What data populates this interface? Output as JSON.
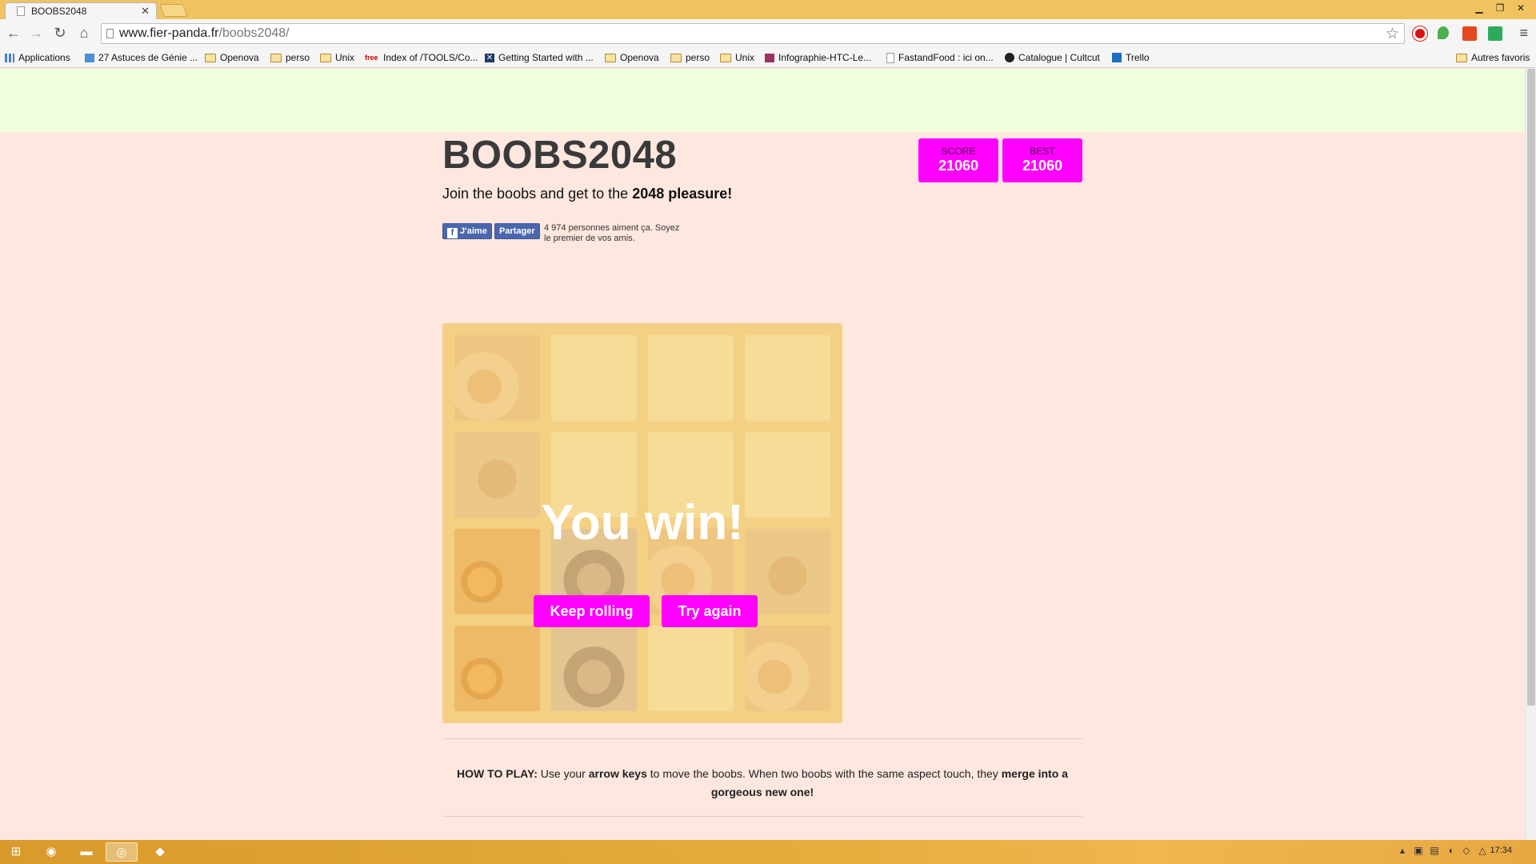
{
  "browser": {
    "tab_title": "BOOBS2048",
    "url_host": "www.fier-panda.fr",
    "url_path": "/boobs2048/",
    "bookmarks": [
      {
        "label": "Applications",
        "icon": "apps-grid-icon"
      },
      {
        "label": "27 Astuces de Génie ...",
        "icon": "bookmark-site-icon"
      },
      {
        "label": "Openova",
        "icon": "folder-icon"
      },
      {
        "label": "perso",
        "icon": "folder-icon"
      },
      {
        "label": "Unix",
        "icon": "folder-icon"
      },
      {
        "label": "Index of /TOOLS/Co...",
        "icon": "free-icon"
      },
      {
        "label": "Getting Started with ...",
        "icon": "x-site-icon"
      },
      {
        "label": "Openova",
        "icon": "folder-icon"
      },
      {
        "label": "perso",
        "icon": "folder-icon"
      },
      {
        "label": "Unix",
        "icon": "folder-icon"
      },
      {
        "label": "Infographie-HTC-Le...",
        "icon": "site-icon"
      },
      {
        "label": "FastandFood : ici on...",
        "icon": "page-icon"
      },
      {
        "label": "Catalogue | Cultcut",
        "icon": "cultcut-icon"
      },
      {
        "label": "Trello",
        "icon": "trello-icon"
      }
    ],
    "other_bookmarks": "Autres favoris"
  },
  "game": {
    "title": "BOOBS2048",
    "score_label": "SCORE",
    "score_value": "21060",
    "best_label": "BEST",
    "best_value": "21060",
    "intro_plain": "Join the boobs and get to the ",
    "intro_bold": "2048 pleasure!",
    "fb_like": "J'aime",
    "fb_share": "Partager",
    "fb_text": "4 974 personnes aiment ça. Soyez le premier de vos amis.",
    "win_message": "You win!",
    "keep_button": "Keep rolling",
    "retry_button": "Try again",
    "grid": [
      [
        1,
        0,
        0,
        0
      ],
      [
        1,
        0,
        0,
        0
      ],
      [
        1,
        1,
        1,
        1
      ],
      [
        1,
        1,
        0,
        1
      ]
    ],
    "howto": {
      "lead": "HOW TO PLAY:",
      "t1": " Use your ",
      "b1": "arrow keys",
      "t2": " to move the boobs. When two boobs with the same aspect touch, they ",
      "b2": "merge into a gorgeous new one!"
    }
  },
  "taskbar": {
    "clock": "17:34"
  },
  "colors": {
    "accent": "#ff00ff",
    "page_bg": "#fde7df",
    "board": "#f2c97b",
    "cell": "#f5dc97"
  }
}
